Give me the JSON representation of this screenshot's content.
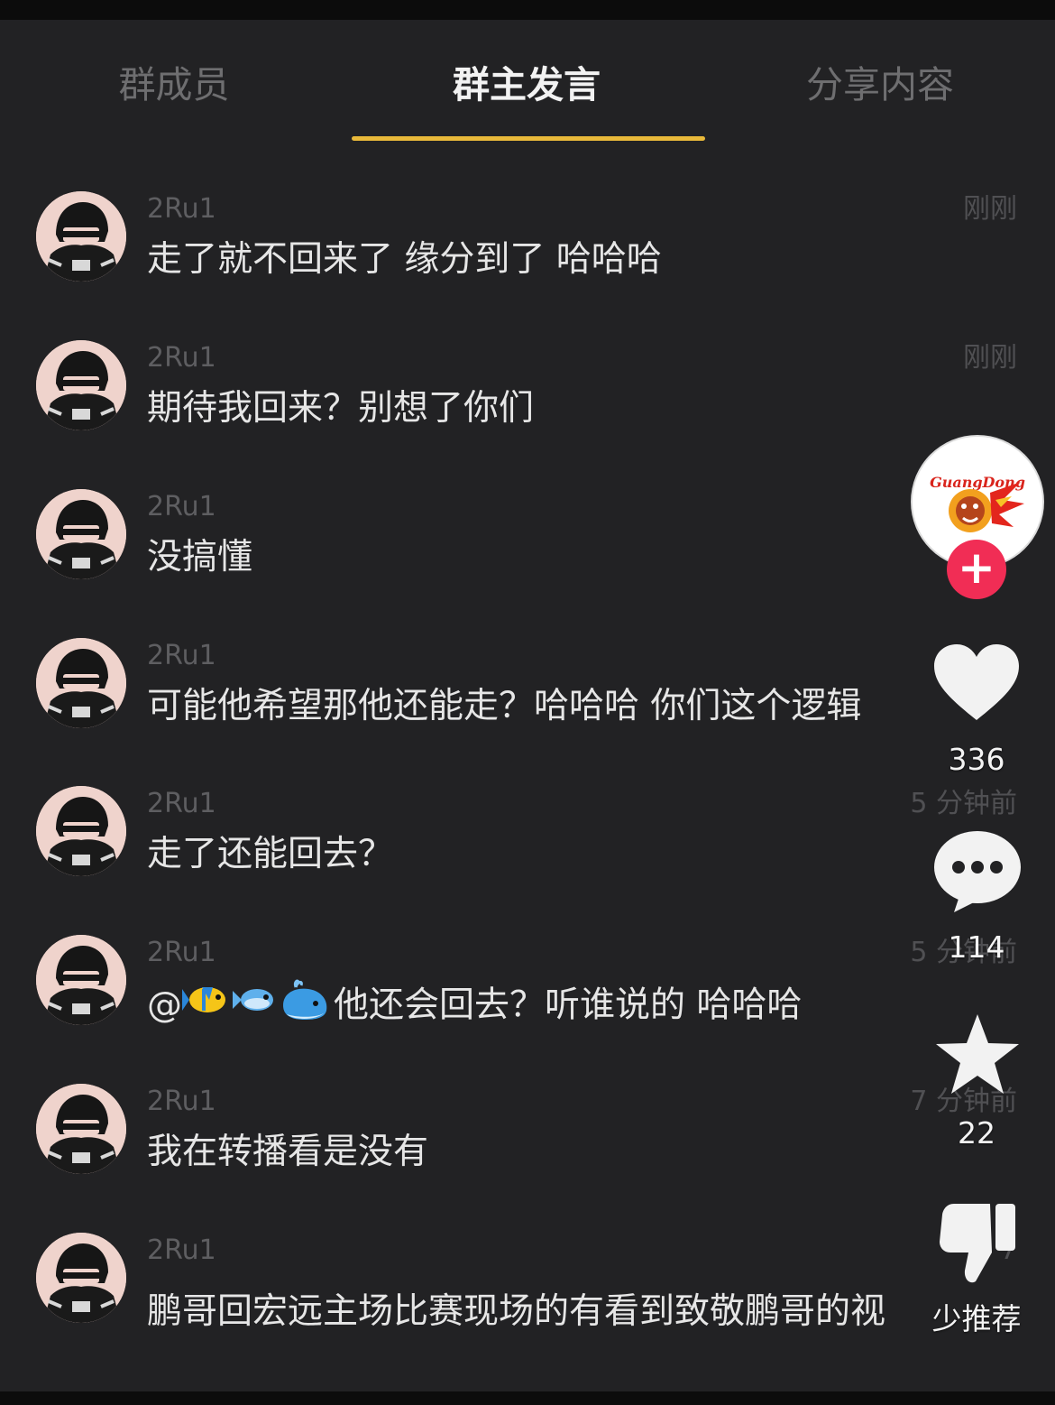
{
  "tabs": [
    {
      "label": "群成员",
      "active": false
    },
    {
      "label": "群主发言",
      "active": true
    },
    {
      "label": "分享内容",
      "active": false
    }
  ],
  "accent_color": "#e9b93a",
  "messages": [
    {
      "user": "2Ru1",
      "time": "刚刚",
      "text": "走了就不回来了 缘分到了 哈哈哈"
    },
    {
      "user": "2Ru1",
      "time": "刚刚",
      "text": "期待我回来？别想了你们"
    },
    {
      "user": "2Ru1",
      "time": "",
      "text": "没搞懂"
    },
    {
      "user": "2Ru1",
      "time": "",
      "text": "可能他希望那他还能走？哈哈哈 你们这个逻辑"
    },
    {
      "user": "2Ru1",
      "time": "5 分钟前",
      "text": "走了还能回去？"
    },
    {
      "user": "2Ru1",
      "time": "5 分钟前",
      "mention": "@",
      "emoji_icons": [
        "tropical-fish-icon",
        "fish-icon",
        "whale-icon"
      ],
      "text": "他还会回去？听谁说的 哈哈哈"
    },
    {
      "user": "2Ru1",
      "time": "7 分钟前",
      "text": "我在转播看是没有"
    },
    {
      "user": "2Ru1",
      "time": "7",
      "text": "鹏哥回宏远主场比赛现场的有看到致敬鹏哥的视"
    }
  ],
  "rail": {
    "profile_logo_text": "GuangDong",
    "follow_symbol": "+",
    "like_count": "336",
    "comment_count": "114",
    "favorite_count": "22",
    "dislike_label": "少推荐",
    "follow_color": "#f12d55"
  }
}
